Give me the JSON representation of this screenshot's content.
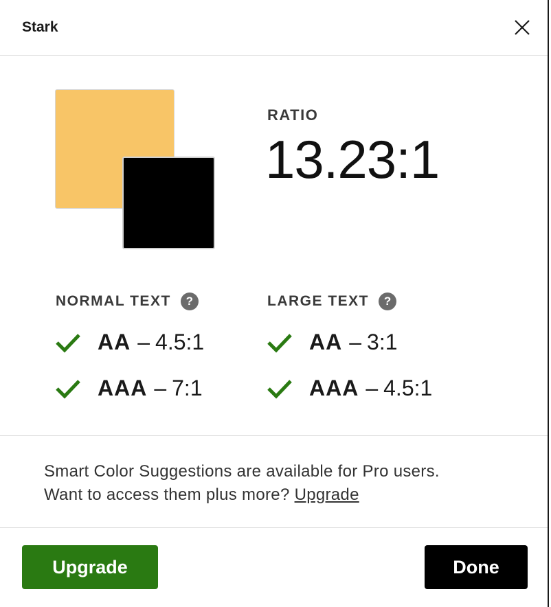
{
  "header": {
    "title": "Stark"
  },
  "colors": {
    "foreground_swatch": "#f8c567",
    "background_swatch": "#000000",
    "pass_green": "#2a7a12",
    "upgrade_button": "#2a7a12",
    "done_button": "#000000"
  },
  "ratio": {
    "label": "RATIO",
    "value": "13.23:1"
  },
  "normal_text": {
    "heading": "NORMAL TEXT",
    "help": "?",
    "checks": [
      {
        "level": "AA",
        "sep": "–",
        "ratio": "4.5:1",
        "status": "pass"
      },
      {
        "level": "AAA",
        "sep": "–",
        "ratio": "7:1",
        "status": "pass"
      }
    ]
  },
  "large_text": {
    "heading": "LARGE TEXT",
    "help": "?",
    "checks": [
      {
        "level": "AA",
        "sep": "–",
        "ratio": "3:1",
        "status": "pass"
      },
      {
        "level": "AAA",
        "sep": "–",
        "ratio": "4.5:1",
        "status": "pass"
      }
    ]
  },
  "promo": {
    "line1": "Smart Color Suggestions are available for Pro users.",
    "line2": "Want to access them plus more?",
    "link": "Upgrade"
  },
  "footer": {
    "upgrade_label": "Upgrade",
    "done_label": "Done"
  }
}
